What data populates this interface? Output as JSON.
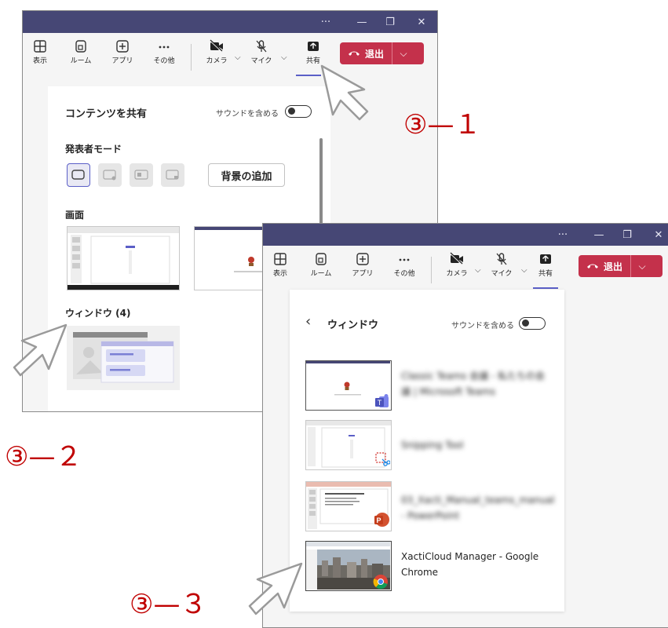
{
  "colors": {
    "titlebar": "#464775",
    "accent": "#5b5fc7",
    "leave": "#c4314b",
    "annotation": "#c00000"
  },
  "titlebar": {
    "more": "···",
    "minimize": "—",
    "restore": "❐",
    "close": "✕"
  },
  "toolbar": {
    "view": "表示",
    "rooms": "ルーム",
    "apps": "アプリ",
    "more": "その他",
    "camera": "カメラ",
    "mic": "マイク",
    "share": "共有",
    "leave": "退出"
  },
  "share_panel": {
    "title": "コンテンツを共有",
    "include_sound": "サウンドを含める",
    "presenter_mode": "発表者モード",
    "add_background": "背景の追加",
    "screen": "画面",
    "window": "ウィンドウ (4)"
  },
  "window_panel": {
    "back": "‹",
    "title": "ウィンドウ",
    "include_sound": "サウンドを含める",
    "items": [
      {
        "icon": "teams-icon",
        "title": "Classic Teams 会議 - 私たちの会議 | Microsoft Teams",
        "blurred": true
      },
      {
        "icon": "snipping-tool-icon",
        "title": "Snipping Tool",
        "blurred": true
      },
      {
        "icon": "powerpoint-icon",
        "title": "03_Xacti_Manual_teams_manual - PowerPoint",
        "blurred": true
      },
      {
        "icon": "chrome-icon",
        "title": "XactiCloud Manager - Google Chrome",
        "blurred": false
      }
    ]
  },
  "annotations": {
    "a1": "③—１",
    "a2": "③—２",
    "a3": "③—３"
  }
}
